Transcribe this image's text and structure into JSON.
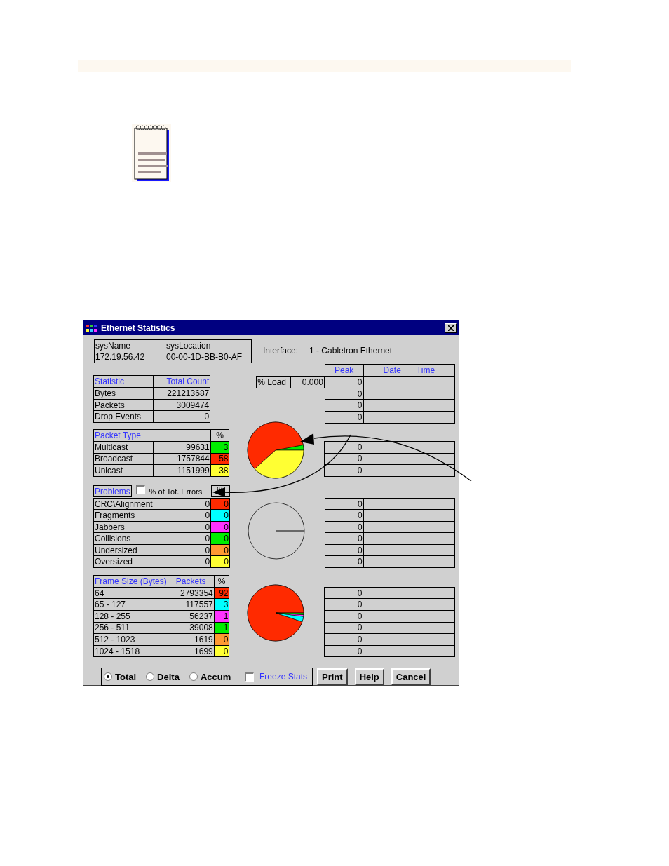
{
  "window": {
    "title": "Ethernet Statistics"
  },
  "system": {
    "columns": [
      "sysName",
      "sysLocation"
    ],
    "values": [
      "172.19.56.42",
      "00-00-1D-BB-B0-AF"
    ]
  },
  "interface": {
    "label": "Interface:",
    "value": "1 - Cabletron Ethernet"
  },
  "peak_header": {
    "peak": "Peak",
    "date": "Date",
    "time": "Time"
  },
  "load": {
    "label": "% Load",
    "value": "0.000"
  },
  "statistics": {
    "columns": [
      "Statistic",
      "Total Count"
    ],
    "rows": [
      {
        "name": "Bytes",
        "count": "221213687"
      },
      {
        "name": "Packets",
        "count": "3009474"
      },
      {
        "name": "Drop Events",
        "count": "0"
      }
    ],
    "peaks": [
      "0",
      "0",
      "0",
      "0"
    ]
  },
  "packet_types": {
    "columns": [
      "Packet Type",
      "%"
    ],
    "rows": [
      {
        "name": "Multicast",
        "count": "99631",
        "percent": "3",
        "color": "#00ee00"
      },
      {
        "name": "Broadcast",
        "count": "1757844",
        "percent": "58",
        "color": "#ff2a00"
      },
      {
        "name": "Unicast",
        "count": "1151999",
        "percent": "38",
        "color": "#ffff33"
      }
    ],
    "peaks": [
      "0",
      "0",
      "0"
    ]
  },
  "problems": {
    "title": "Problems",
    "toggle": {
      "label": "% of Tot. Errors",
      "checked": false
    },
    "percent_header": "%",
    "rows": [
      {
        "name": "CRC\\Alignment",
        "count": "0",
        "percent": "0",
        "color": "#ff2a00"
      },
      {
        "name": "Fragments",
        "count": "0",
        "percent": "0",
        "color": "#00ffff"
      },
      {
        "name": "Jabbers",
        "count": "0",
        "percent": "0",
        "color": "#ff33ff"
      },
      {
        "name": "Collisions",
        "count": "0",
        "percent": "0",
        "color": "#00ee00"
      },
      {
        "name": "Undersized",
        "count": "0",
        "percent": "0",
        "color": "#ff9933"
      },
      {
        "name": "Oversized",
        "count": "0",
        "percent": "0",
        "color": "#ffff33"
      }
    ],
    "peaks": [
      "0",
      "0",
      "0",
      "0",
      "0",
      "0"
    ]
  },
  "frame_sizes": {
    "columns": [
      "Frame Size (Bytes)",
      "Packets",
      "%"
    ],
    "rows": [
      {
        "name": "64",
        "count": "2793354",
        "percent": "92",
        "color": "#ff2a00"
      },
      {
        "name": "65 - 127",
        "count": "117557",
        "percent": "3",
        "color": "#00ffff"
      },
      {
        "name": "128 - 255",
        "count": "56237",
        "percent": "1",
        "color": "#ff33ff"
      },
      {
        "name": "256 - 511",
        "count": "39008",
        "percent": "1",
        "color": "#00ee00"
      },
      {
        "name": "512 - 1023",
        "count": "1619",
        "percent": "0",
        "color": "#ff9933"
      },
      {
        "name": "1024 - 1518",
        "count": "1699",
        "percent": "0",
        "color": "#ffff33"
      }
    ],
    "peaks": [
      "0",
      "0",
      "0",
      "0",
      "0",
      "0"
    ]
  },
  "modes": [
    {
      "label": "Total",
      "selected": true
    },
    {
      "label": "Delta",
      "selected": false
    },
    {
      "label": "Accum",
      "selected": false
    }
  ],
  "freeze": {
    "label": "Freeze Stats",
    "checked": false
  },
  "buttons": [
    "Print",
    "Help",
    "Cancel"
  ]
}
